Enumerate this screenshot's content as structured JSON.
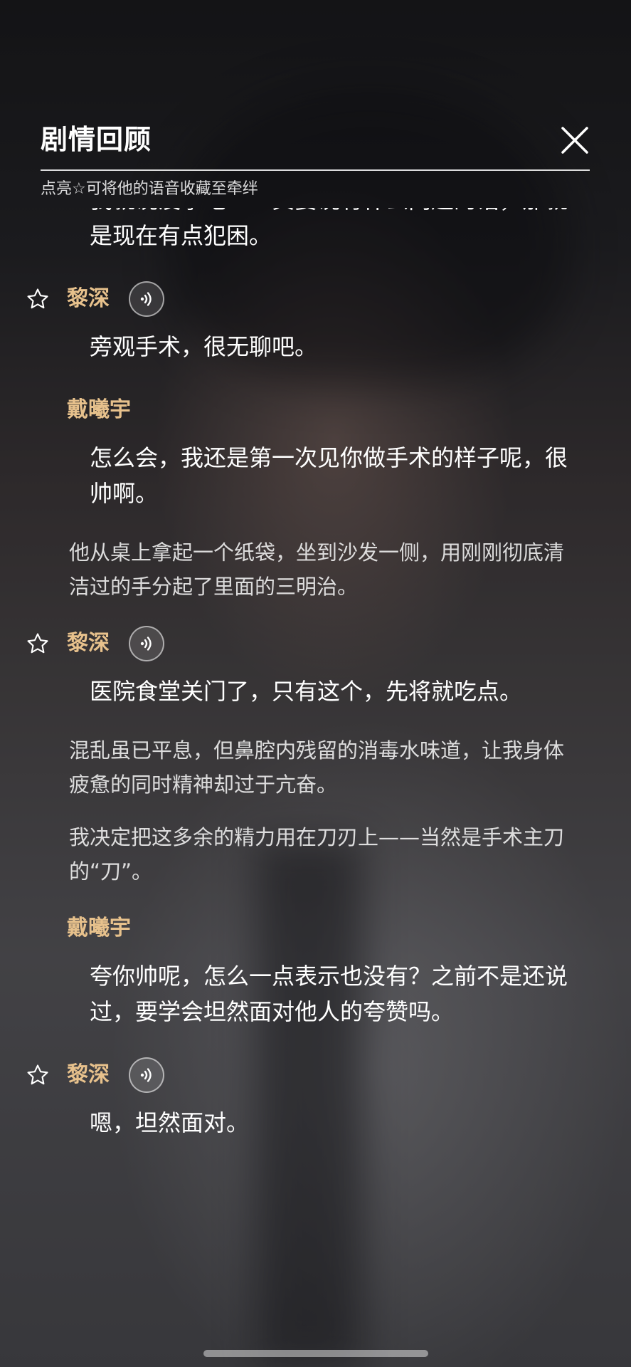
{
  "header": {
    "title": "剧情回顾",
    "hint": "点亮☆可将他的语音收藏至牵绊"
  },
  "entries": [
    {
      "type": "dialog",
      "speaker": "",
      "text": "我就说没事吧——真要说有什么问题的话，那就是现在有点犯困。",
      "partial_top": true
    },
    {
      "type": "dialog",
      "speaker": "黎深",
      "favoritable": true,
      "voice": true,
      "text": "旁观手术，很无聊吧。"
    },
    {
      "type": "dialog",
      "speaker": "戴曦宇",
      "text": "怎么会，我还是第一次见你做手术的样子呢，很帅啊。"
    },
    {
      "type": "narration",
      "text": "他从桌上拿起一个纸袋，坐到沙发一侧，用刚刚彻底清洁过的手分起了里面的三明治。"
    },
    {
      "type": "dialog",
      "speaker": "黎深",
      "favoritable": true,
      "voice": true,
      "text": "医院食堂关门了，只有这个，先将就吃点。"
    },
    {
      "type": "narration",
      "text": "混乱虽已平息，但鼻腔内残留的消毒水味道，让我身体疲惫的同时精神却过于亢奋。"
    },
    {
      "type": "narration",
      "text": "我决定把这多余的精力用在刀刃上——当然是手术主刀的“刀”。"
    },
    {
      "type": "dialog",
      "speaker": "戴曦宇",
      "text": "夸你帅呢，怎么一点表示也没有？之前不是还说过，要学会坦然面对他人的夸赞吗。"
    },
    {
      "type": "dialog",
      "speaker": "黎深",
      "favoritable": true,
      "voice": true,
      "text": "嗯，坦然面对。"
    }
  ],
  "colors": {
    "speaker": "#e7c18c",
    "text": "#ffffff"
  },
  "icons": {
    "close": "close-icon",
    "star": "star-outline-icon",
    "voice": "sound-wave-icon"
  }
}
